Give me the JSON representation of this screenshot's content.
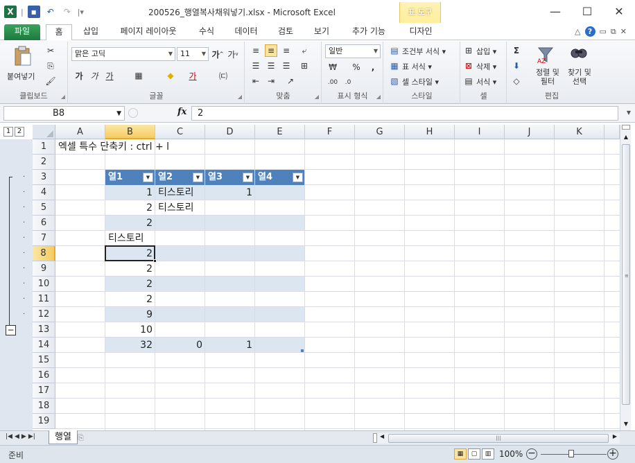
{
  "titlebar": {
    "title": "200526_행열복사채워넣기.xlsx - Microsoft Excel",
    "table_tools": "표 도구",
    "minimize": "—",
    "maximize": "☐",
    "close": "✕"
  },
  "tabs": {
    "file": "파일",
    "home": "홈",
    "insert": "삽입",
    "page_layout": "페이지 레이아웃",
    "formulas": "수식",
    "data": "데이터",
    "review": "검토",
    "view": "보기",
    "addins": "추가 기능",
    "design": "디자인"
  },
  "ribbon": {
    "clipboard": {
      "paste": "붙여넣기",
      "label": "클립보드"
    },
    "font": {
      "name": "맑은 고딕",
      "size": "11",
      "label": "글꼴",
      "bold": "가",
      "italic": "가",
      "underline": "가"
    },
    "alignment": {
      "label": "맞춤"
    },
    "number": {
      "format": "일반",
      "label": "표시 형식",
      "percent": "%",
      "comma": ","
    },
    "styles": {
      "conditional": "조건부 서식",
      "format_table": "표 서식",
      "cell_styles": "셀 스타일",
      "label": "스타일"
    },
    "cells": {
      "insert": "삽입",
      "delete": "삭제",
      "format": "서식",
      "label": "셀"
    },
    "editing": {
      "sum": "Σ",
      "sort_filter": "정렬 및 필터",
      "find_select": "찾기 및 선택",
      "label": "편집"
    }
  },
  "formula_bar": {
    "name_box": "B8",
    "fx": "fx",
    "value": "2"
  },
  "outline": {
    "levels": [
      "1",
      "2"
    ],
    "collapse": "−",
    "dot": "·"
  },
  "columns": [
    "A",
    "B",
    "C",
    "D",
    "E",
    "F",
    "G",
    "H",
    "I",
    "J",
    "K"
  ],
  "rows": [
    "1",
    "2",
    "3",
    "4",
    "5",
    "6",
    "7",
    "8",
    "9",
    "10",
    "11",
    "12",
    "13",
    "14",
    "15",
    "16",
    "17",
    "18",
    "19"
  ],
  "sheet": {
    "a1": "엑셀 특수 단축키 : ctrl + l",
    "table_headers": [
      "열1",
      "열2",
      "열3",
      "열4"
    ],
    "table_rows": [
      {
        "b": "1",
        "c": "티스토리",
        "d": "1",
        "e": ""
      },
      {
        "b": "2",
        "c": "티스토리",
        "d": "",
        "e": ""
      },
      {
        "b": "2",
        "c": "",
        "d": "",
        "e": ""
      },
      {
        "b": "티스토리",
        "c": "",
        "d": "",
        "e": ""
      },
      {
        "b": "2",
        "c": "",
        "d": "",
        "e": ""
      },
      {
        "b": "2",
        "c": "",
        "d": "",
        "e": ""
      },
      {
        "b": "2",
        "c": "",
        "d": "",
        "e": ""
      },
      {
        "b": "2",
        "c": "",
        "d": "",
        "e": ""
      },
      {
        "b": "9",
        "c": "",
        "d": "",
        "e": ""
      },
      {
        "b": "10",
        "c": "",
        "d": "",
        "e": ""
      },
      {
        "b": "32",
        "c": "0",
        "d": "1",
        "e": ""
      }
    ]
  },
  "sheet_tabs": {
    "active": "행열"
  },
  "status": {
    "ready": "준비",
    "zoom": "100%",
    "zoom_minus": "−",
    "zoom_plus": "+"
  },
  "colors": {
    "table_header": "#4f81bd",
    "band": "#dce6f1",
    "file_tab": "#1d7a3e",
    "active_header": "#f4cb63"
  }
}
